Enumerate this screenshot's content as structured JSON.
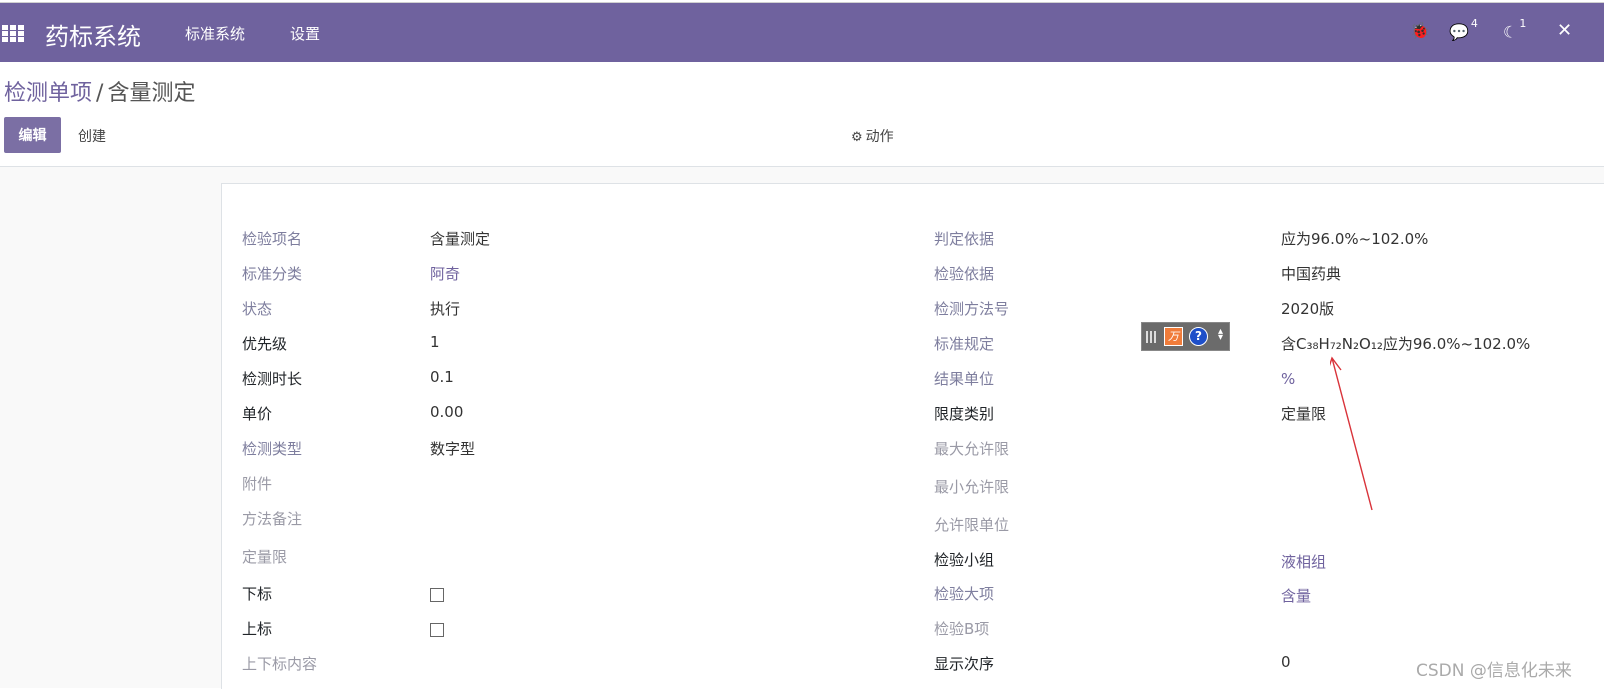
{
  "navbar": {
    "brand": "药标系统",
    "menus": [
      "标准系统",
      "设置"
    ],
    "icons": [
      {
        "name": "bug-icon",
        "glyph": "🐞",
        "badge": ""
      },
      {
        "name": "chat-icon",
        "glyph": "💬",
        "badge": "4"
      },
      {
        "name": "activity-icon",
        "glyph": "☾",
        "badge": "1"
      },
      {
        "name": "close-icon",
        "glyph": "✕",
        "badge": ""
      }
    ]
  },
  "breadcrumb": {
    "parent": "检测单项",
    "separator": "/",
    "current": "含量测定"
  },
  "buttons": {
    "edit": "编辑",
    "create": "创建",
    "action": "动作"
  },
  "form": {
    "left": [
      {
        "label": "检验项名",
        "value": "含量测定"
      },
      {
        "label": "标准分类",
        "value": "阿奇"
      },
      {
        "label": "状态",
        "value": "执行"
      },
      {
        "label": "优先级",
        "value": "1"
      },
      {
        "label": "检测时长",
        "value": "0.1"
      },
      {
        "label": "单价",
        "value": "0.00"
      },
      {
        "label": "检测类型",
        "value": "数字型"
      },
      {
        "label": "附件",
        "value": ""
      },
      {
        "label": "方法备注",
        "value": ""
      },
      {
        "label": "定量限",
        "value": ""
      },
      {
        "label": "下标",
        "value": false
      },
      {
        "label": "上标",
        "value": false
      },
      {
        "label": "上下标内容",
        "value": ""
      }
    ],
    "right": [
      {
        "label": "判定依据",
        "value": "应为96.0%~102.0%"
      },
      {
        "label": "检验依据",
        "value": "中国药典"
      },
      {
        "label": "检测方法号",
        "value": "2020版"
      },
      {
        "label": "标准规定",
        "value": "含C₃₈H₇₂N₂O₁₂应为96.0%~102.0%"
      },
      {
        "label": "结果单位",
        "value": "%"
      },
      {
        "label": "限度类别",
        "value": "定量限"
      },
      {
        "label": "最大允许限",
        "value": ""
      },
      {
        "label": "最小允许限",
        "value": ""
      },
      {
        "label": "允许限单位",
        "value": ""
      },
      {
        "label": "检验小组",
        "value": "液相组"
      },
      {
        "label": "检验大项",
        "value": "含量"
      },
      {
        "label": "检验B项",
        "value": ""
      },
      {
        "label": "显示次序",
        "value": "0"
      }
    ]
  },
  "toolbar_widget": {
    "logo_text": "万",
    "help_text": "?"
  },
  "watermark": "CSDN @信息化未来"
}
